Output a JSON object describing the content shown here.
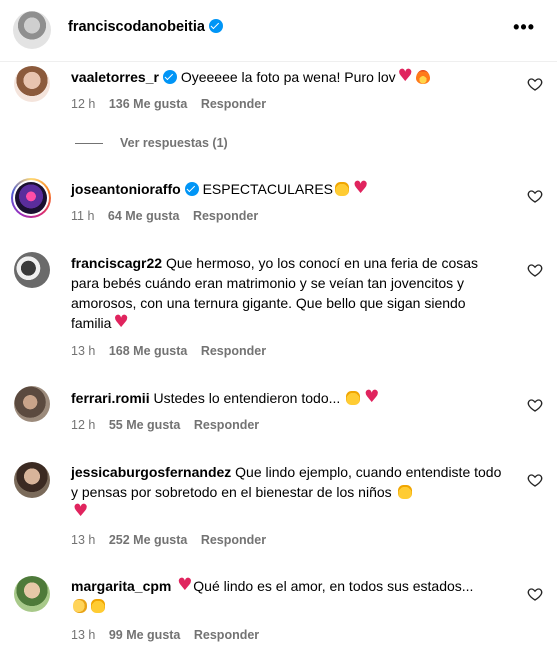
{
  "header": {
    "username": "franciscodanobeitia",
    "verified": true,
    "more_icon": "more-horizontal-icon"
  },
  "comments": [
    {
      "user": "vaaletorres_r",
      "verified": true,
      "text": "Oyeeeee la foto pa wena! Puro lov",
      "emojis": [
        "heart",
        "fire"
      ],
      "time": "12 h",
      "likes": "136 Me gusta",
      "reply": "Responder",
      "replies_link": "Ver respuestas (1)"
    },
    {
      "user": "joseantonioraffo",
      "verified": true,
      "text": "ESPECTACULARES",
      "emojis": [
        "raising-hands",
        "heart"
      ],
      "time": "11 h",
      "likes": "64 Me gusta",
      "reply": "Responder"
    },
    {
      "user": "franciscagr22",
      "verified": false,
      "text": "Que hermoso, yo los conocí en una feria de cosas para bebés cuándo eran matrimonio y se veían tan jovencitos y amorosos, con una ternura gigante. Que bello que sigan siendo familia",
      "emojis": [
        "heart"
      ],
      "time": "13 h",
      "likes": "168 Me gusta",
      "reply": "Responder"
    },
    {
      "user": "ferrari.romii",
      "verified": false,
      "text": "Ustedes lo entendieron todo...",
      "emojis": [
        "raising-hands",
        "heart"
      ],
      "time": "12 h",
      "likes": "55 Me gusta",
      "reply": "Responder"
    },
    {
      "user": "jessicaburgosfernandez",
      "verified": false,
      "text": "Que lindo ejemplo, cuando entendiste todo y pensas por sobretodo en el bienestar de los niños",
      "emojis": [
        "raising-hands",
        "heart"
      ],
      "time": "13 h",
      "likes": "252 Me gusta",
      "reply": "Responder"
    },
    {
      "user": "margarita_cpm",
      "verified": false,
      "text_before": "Qué lindo es el amor, en todos sus estados...",
      "emojis": [
        "heart",
        "clapping-hands",
        "raising-hands"
      ],
      "time": "13 h",
      "likes": "99 Me gusta",
      "reply": "Responder"
    }
  ]
}
